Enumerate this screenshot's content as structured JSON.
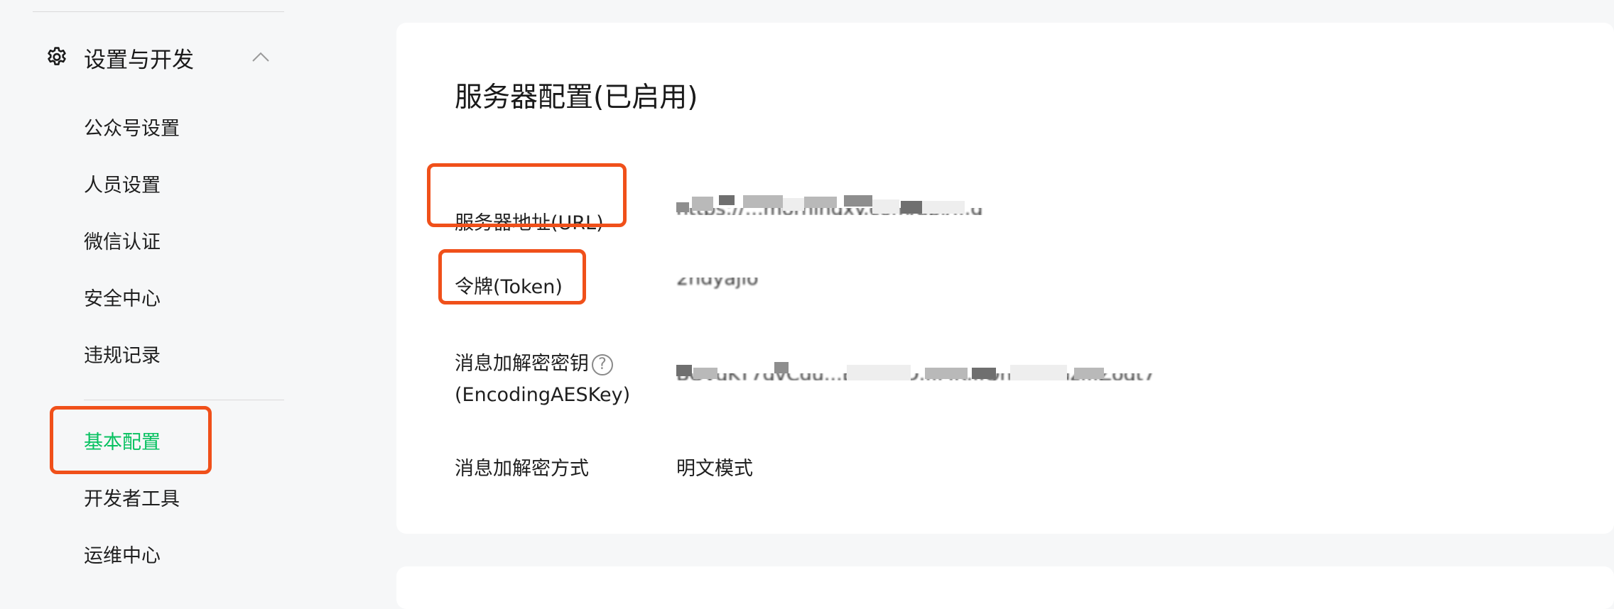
{
  "sidebar": {
    "section_title": "设置与开发",
    "items": [
      {
        "label": "公众号设置"
      },
      {
        "label": "人员设置"
      },
      {
        "label": "微信认证"
      },
      {
        "label": "安全中心"
      },
      {
        "label": "违规记录"
      },
      {
        "label": "基本配置",
        "active": true
      },
      {
        "label": "开发者工具"
      },
      {
        "label": "运维中心"
      }
    ]
  },
  "server_config": {
    "title": "服务器配置(已启用)",
    "rows": [
      {
        "label": "服务器地址(URL)",
        "value": "https://...morningxy.com/api/...g"
      },
      {
        "label": "令牌(Token)",
        "value": "2hdyajlo"
      },
      {
        "label_line1": "消息加解密密钥",
        "label_line2": "(EncodingAESKey)",
        "value": "BOvqKT7gvCdu...BC...3iD...MK...QhE...wdz...Zoqt7"
      },
      {
        "label": "消息加解密方式",
        "value": "明文模式"
      }
    ],
    "help_glyph": "?"
  },
  "icons": {
    "settings": "gear-icon",
    "collapse": "chevron-up-icon",
    "help": "question-circle-icon"
  },
  "colors": {
    "accent_green": "#07c160",
    "annotation_red": "#f0501a",
    "page_bg": "#f6f7f8"
  }
}
